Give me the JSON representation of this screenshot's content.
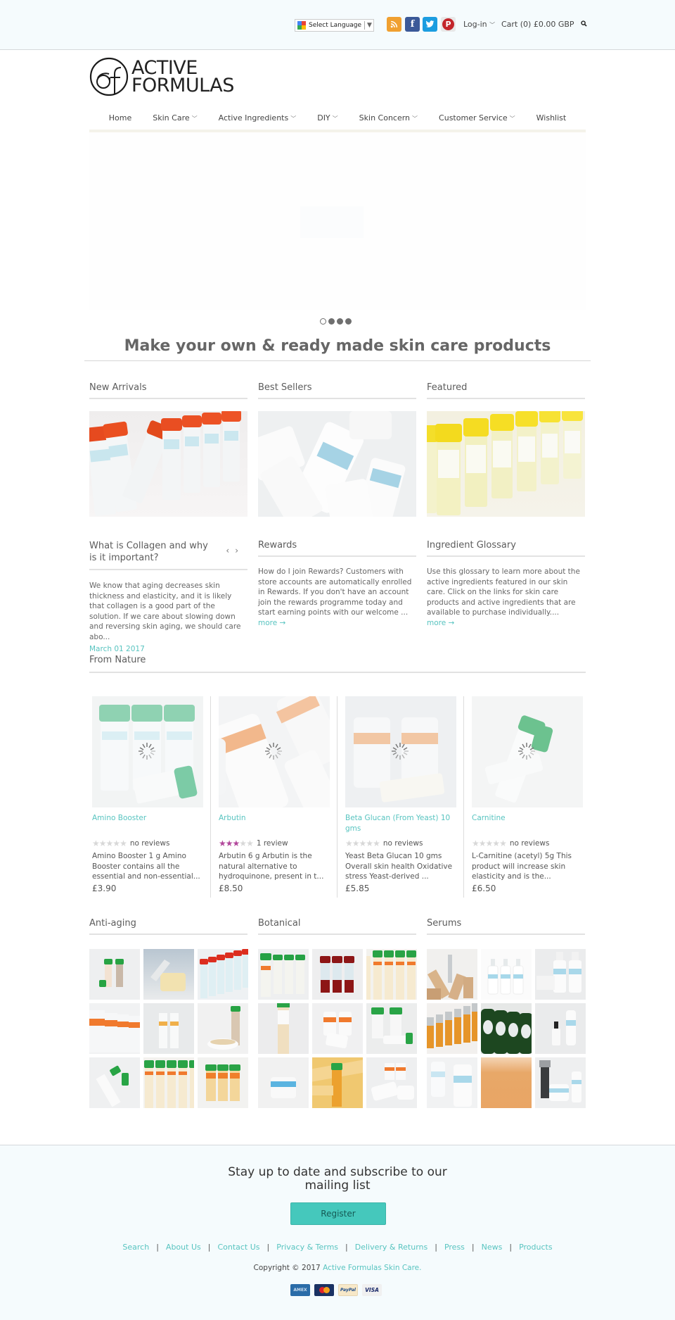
{
  "topbar": {
    "language_select": "Select Language",
    "social": [
      {
        "name": "rss",
        "icon": "rss-icon",
        "glyph": "≡"
      },
      {
        "name": "facebook",
        "icon": "facebook-icon",
        "glyph": "f"
      },
      {
        "name": "twitter",
        "icon": "twitter-icon",
        "glyph": "t"
      },
      {
        "name": "pinterest",
        "icon": "pinterest-icon",
        "glyph": "P"
      }
    ],
    "login": "Log-in",
    "cart": "Cart (0) £0.00 GBP",
    "search_icon": "search-icon"
  },
  "logo": {
    "line1": "ACTIVE",
    "line2": "FORMULAS"
  },
  "nav": [
    {
      "label": "Home",
      "dropdown": false
    },
    {
      "label": "Skin Care",
      "dropdown": true
    },
    {
      "label": "Active Ingredients",
      "dropdown": true
    },
    {
      "label": "DIY",
      "dropdown": true
    },
    {
      "label": "Skin Concern",
      "dropdown": true
    },
    {
      "label": "Customer Service",
      "dropdown": true
    },
    {
      "label": "Wishlist",
      "dropdown": false
    }
  ],
  "slideshow": {
    "slide_count": 4,
    "active_slide": 1
  },
  "tagline": "Make your own & ready made skin care products",
  "collections": [
    {
      "title": "New Arrivals",
      "image": "red-cap-vials"
    },
    {
      "title": "Best Sellers",
      "image": "collagen-serum-bottles"
    },
    {
      "title": "Featured",
      "image": "yellow-cap-vials"
    }
  ],
  "blog": {
    "title": "What is Collagen and why is it important?",
    "prev": "‹",
    "next": "›",
    "excerpt": "We know that aging decreases skin thickness and elasticity, and it is likely that collagen is a good part of the solution. If we care about slowing down and reversing skin aging, we should care abo...",
    "date": "March 01 2017"
  },
  "rewards": {
    "title": "Rewards",
    "text": "How do I join Rewards? Customers with store accounts are automatically enrolled in Rewards. If you don't have an account join the rewards programme today and start earning points with our welcome ...",
    "more": "more →"
  },
  "glossary": {
    "title": "Ingredient Glossary",
    "text": "Use this glossary to learn more about the active ingredients featured in our skin care. Click on the links for skin care products and active ingredients that are available to purchase individually....",
    "more": "more →"
  },
  "from_nature": {
    "title": "From Nature",
    "products": [
      {
        "name": "Amino Booster",
        "rating": 0,
        "reviews": "no reviews",
        "description": "Amino Booster 1 g Amino Booster contains all the essential and non-essential...",
        "price": "£3.90"
      },
      {
        "name": "Arbutin",
        "rating": 3,
        "reviews": "1 review",
        "description": "Arbutin 6 g Arbutin is the natural alternative to hydroquinone, present in t...",
        "price": "£8.50"
      },
      {
        "name": "Beta Glucan (From Yeast) 10 gms",
        "rating": 0,
        "reviews": "no reviews",
        "description": "Yeast Beta Glucan 10 gms Overall skin health Oxidative stress Yeast-derived ...",
        "price": "£5.85"
      },
      {
        "name": "Carnitine",
        "rating": 0,
        "reviews": "no reviews",
        "description": "L-Carnitine (acetyl) 5g This product will increase skin elasticity and is the...",
        "price": "£6.50"
      }
    ]
  },
  "categories": [
    {
      "title": "Anti-aging"
    },
    {
      "title": "Botanical"
    },
    {
      "title": "Serums"
    }
  ],
  "footer": {
    "subscribe_title": "Stay up to date and subscribe to our mailing list",
    "register": "Register",
    "links": [
      "Search",
      "About Us",
      "Contact Us",
      "Privacy & Terms",
      "Delivery & Returns",
      "Press",
      "News",
      "Products"
    ],
    "copyright_prefix": "Copyright © 2017 ",
    "copyright_link": "Active Formulas Skin Care.",
    "payment_cards": [
      "American Express",
      "MasterCard",
      "PayPal",
      "VISA"
    ]
  },
  "colors": {
    "accent": "#58c4c0",
    "button": "#45c8bc",
    "star": "#b2479b",
    "topbar_bg": "#f5fbfd"
  }
}
